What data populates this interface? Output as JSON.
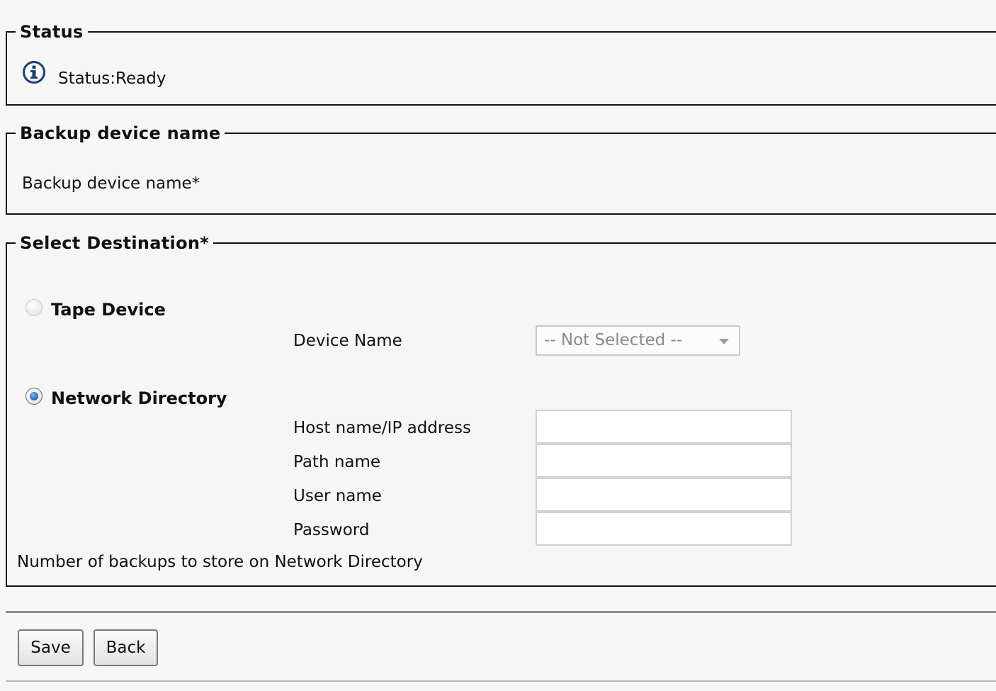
{
  "status_section": {
    "legend": "Status",
    "status_text": "Status:Ready",
    "icon": "info-icon"
  },
  "backup_section": {
    "legend": "Backup device name",
    "field_label": "Backup device name*"
  },
  "destination_section": {
    "legend": "Select Destination*",
    "tape": {
      "label": "Tape Device",
      "selected": false,
      "device_name_label": "Device Name",
      "device_name_value": "-- Not Selected --"
    },
    "network": {
      "label": "Network Directory",
      "selected": true,
      "fields": [
        {
          "label": "Host name/IP address",
          "value": ""
        },
        {
          "label": "Path name",
          "value": ""
        },
        {
          "label": "User name",
          "value": ""
        },
        {
          "label": "Password",
          "value": ""
        }
      ],
      "backups_label": "Number of backups to store on Network Directory"
    }
  },
  "actions": {
    "save_label": "Save",
    "back_label": "Back"
  },
  "colors": {
    "background": "#f6f6f6",
    "radio_selected": "#2a6fb8",
    "info_icon": "#1f3f72"
  }
}
